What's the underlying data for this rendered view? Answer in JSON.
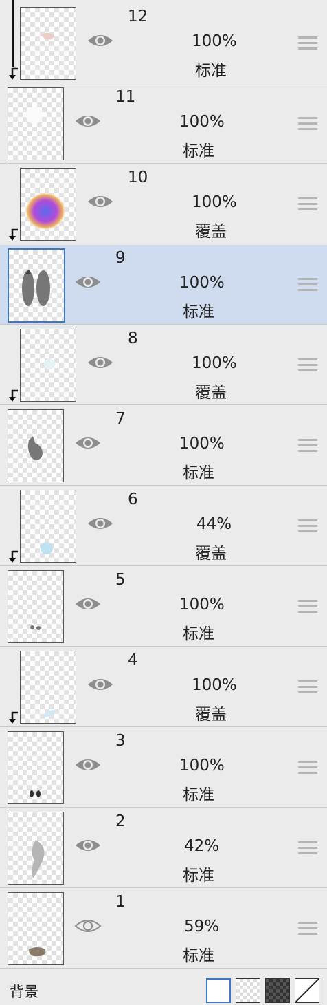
{
  "layers": [
    {
      "number": "12",
      "opacity": "100%",
      "mode": "标准",
      "visible": true,
      "clipped": true,
      "selected": false,
      "thumb_icon": "faint-sketch"
    },
    {
      "number": "11",
      "opacity": "100%",
      "mode": "标准",
      "visible": true,
      "clipped": false,
      "selected": false,
      "thumb_icon": "white-blob"
    },
    {
      "number": "10",
      "opacity": "100%",
      "mode": "覆盖",
      "visible": true,
      "clipped": true,
      "selected": false,
      "thumb_icon": "color-gradient-blob"
    },
    {
      "number": "9",
      "opacity": "100%",
      "mode": "标准",
      "visible": true,
      "clipped": false,
      "selected": true,
      "thumb_icon": "gray-figure-pair"
    },
    {
      "number": "8",
      "opacity": "100%",
      "mode": "覆盖",
      "visible": true,
      "clipped": true,
      "selected": false,
      "thumb_icon": "faint-cyan"
    },
    {
      "number": "7",
      "opacity": "100%",
      "mode": "标准",
      "visible": true,
      "clipped": false,
      "selected": false,
      "thumb_icon": "gray-figure"
    },
    {
      "number": "6",
      "opacity": "44%",
      "mode": "覆盖",
      "visible": true,
      "clipped": true,
      "selected": false,
      "thumb_icon": "cyan-splash"
    },
    {
      "number": "5",
      "opacity": "100%",
      "mode": "标准",
      "visible": true,
      "clipped": false,
      "selected": false,
      "thumb_icon": "small-marks"
    },
    {
      "number": "4",
      "opacity": "100%",
      "mode": "覆盖",
      "visible": true,
      "clipped": true,
      "selected": false,
      "thumb_icon": "cyan-splash-lower"
    },
    {
      "number": "3",
      "opacity": "100%",
      "mode": "标准",
      "visible": true,
      "clipped": false,
      "selected": false,
      "thumb_icon": "dark-marks"
    },
    {
      "number": "2",
      "opacity": "42%",
      "mode": "标准",
      "visible": true,
      "clipped": false,
      "selected": false,
      "thumb_icon": "gray-smoke"
    },
    {
      "number": "1",
      "opacity": "59%",
      "mode": "标准",
      "visible": false,
      "clipped": false,
      "selected": false,
      "thumb_icon": "brown-object"
    }
  ],
  "footer": {
    "label": "背景"
  },
  "icons": {
    "visibility": "eye-icon",
    "drag": "drag-handle-icon",
    "clip": "clip-arrow-icon"
  },
  "colors": {
    "selected_row": "#cfdcef",
    "selected_border": "#3a78c5",
    "panel_bg": "#ecebec"
  }
}
